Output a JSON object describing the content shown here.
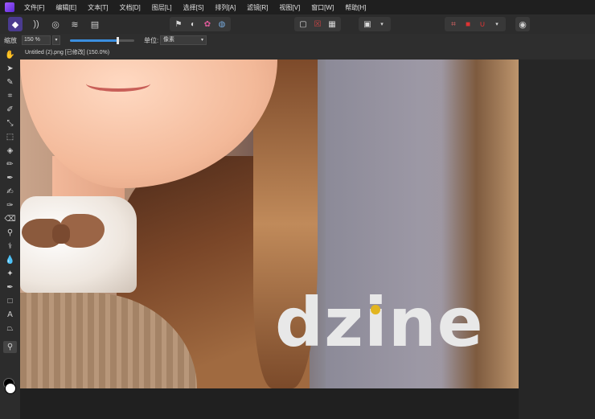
{
  "menu": [
    "文件[F]",
    "编辑[E]",
    "文本[T]",
    "文档[D]",
    "图层[L]",
    "选择[S]",
    "排列[A]",
    "滤镜[R]",
    "视图[V]",
    "窗口[W]",
    "帮助[H]"
  ],
  "toolbar": {
    "app_mode_icon": "affinity-photo-icon",
    "persona_icons": [
      "develop-persona-icon",
      "liquify-persona-icon",
      "tone-map-persona-icon",
      "export-persona-icon"
    ],
    "mid_icons": [
      "flag-icon",
      "eraser-icon",
      "color-wheel-icon",
      "swatch-icon"
    ],
    "view_icons": [
      "frame-icon",
      "crossed-frame-icon",
      "grid-icon"
    ],
    "quickmask_icon": "quick-mask-icon",
    "right_icons": [
      "crop-icon",
      "record-icon",
      "magnet-icon",
      "chat-icon"
    ]
  },
  "context": {
    "zoom_label": "缩放",
    "zoom_value": "150 %",
    "zoom_slider_fraction": 0.75,
    "units_label": "单位:",
    "units_value": "像素"
  },
  "document": {
    "title": "Untitled (2).png [已修改] (150.0%)"
  },
  "tools": [
    "hand-tool-icon",
    "move-tool-icon",
    "color-picker-icon",
    "crop-tool-icon",
    "paint-brush-icon",
    "selection-brush-icon",
    "rectangle-marquee-icon",
    "flood-fill-icon",
    "pixel-tool-icon",
    "paint-mixer-icon",
    "smudge-icon",
    "dodge-burn-icon",
    "eraser-tool-icon",
    "clone-stamp-icon",
    "healing-brush-icon",
    "blur-icon",
    "red-eye-icon",
    "pen-tool-icon",
    "shape-tool-icon",
    "text-tool-icon",
    "perspective-icon",
    "zoom-tool-icon"
  ],
  "image": {
    "logo_text": "dzine",
    "logo_dot_color": "#e2b520"
  }
}
